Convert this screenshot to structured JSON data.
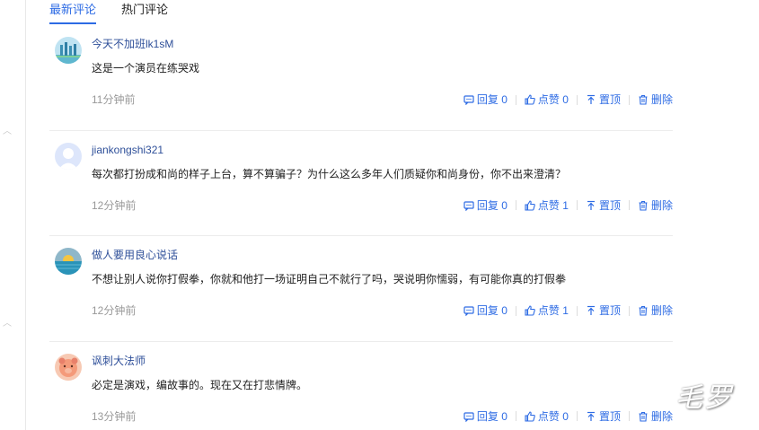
{
  "tabs": [
    {
      "label": "最新评论",
      "active": true
    },
    {
      "label": "热门评论",
      "active": false
    }
  ],
  "actions": {
    "reply_label": "回复",
    "like_label": "点赞",
    "pin_label": "置顶",
    "delete_label": "删除"
  },
  "comments": [
    {
      "username": "今天不加班lk1sM",
      "content": "这是一个演员在练哭戏",
      "time": "11分钟前",
      "replies": "0",
      "likes": "0",
      "avatar_icon": "city-skyline-avatar"
    },
    {
      "username": "jiankongshi321",
      "content": "每次都打扮成和尚的样子上台，算不算骗子？为什么这么多年人们质疑你和尚身份，你不出来澄清？",
      "time": "12分钟前",
      "replies": "0",
      "likes": "1",
      "avatar_icon": "default-user-avatar"
    },
    {
      "username": "做人要用良心说话",
      "content": "不想让别人说你打假拳，你就和他打一场证明自己不就行了吗，哭说明你懦弱，有可能你真的打假拳",
      "time": "12分钟前",
      "replies": "0",
      "likes": "1",
      "avatar_icon": "sunset-sea-avatar"
    },
    {
      "username": "讽刺大法师",
      "content": "必定是演戏，编故事的。现在又在打悲情牌。",
      "time": "13分钟前",
      "replies": "0",
      "likes": "0",
      "avatar_icon": "cartoon-pig-avatar"
    }
  ],
  "watermark": "毛罗",
  "colors": {
    "accent": "#2d6be4",
    "username": "#2e4f99",
    "muted": "#999999"
  }
}
